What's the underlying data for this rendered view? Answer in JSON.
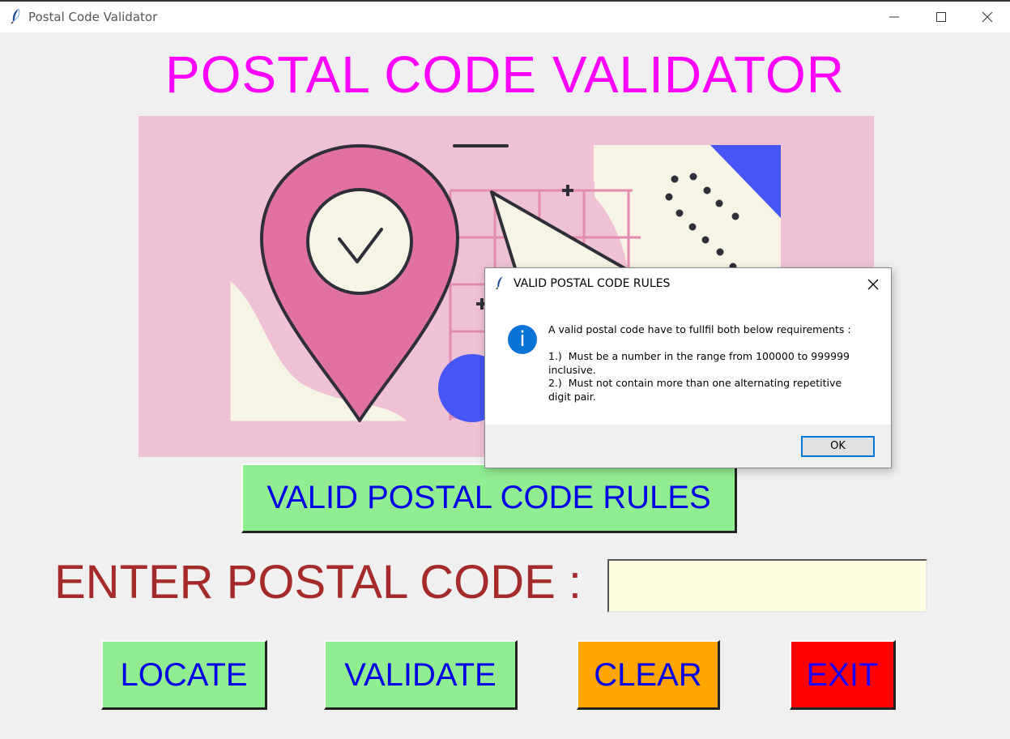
{
  "window": {
    "title": "Postal Code Validator",
    "icon": "feather-icon"
  },
  "app": {
    "heading": "POSTAL CODE VALIDATOR",
    "rules_button": "VALID POSTAL CODE RULES",
    "enter_label": "ENTER POSTAL CODE :",
    "postal_input": {
      "value": "",
      "placeholder": ""
    },
    "buttons": {
      "locate": "LOCATE",
      "validate": "VALIDATE",
      "clear": "CLEAR",
      "exit": "EXIT"
    }
  },
  "colors": {
    "heading": "#ff00ff",
    "button_green": "#90ee90",
    "button_orange": "#ffa500",
    "button_red": "#ff0000",
    "button_text": "#0000e6",
    "label": "#a52a2a",
    "input_bg": "#fffde0"
  },
  "dialog": {
    "title": "VALID POSTAL CODE RULES",
    "icon": "info-icon",
    "message": "A valid postal code have to fullfil both below requirements :\n\n1.)  Must be a number in the range from 100000 to 999999\ninclusive.\n2.)  Must not contain more than one alternating repetitive\ndigit pair.",
    "ok_label": "OK"
  }
}
